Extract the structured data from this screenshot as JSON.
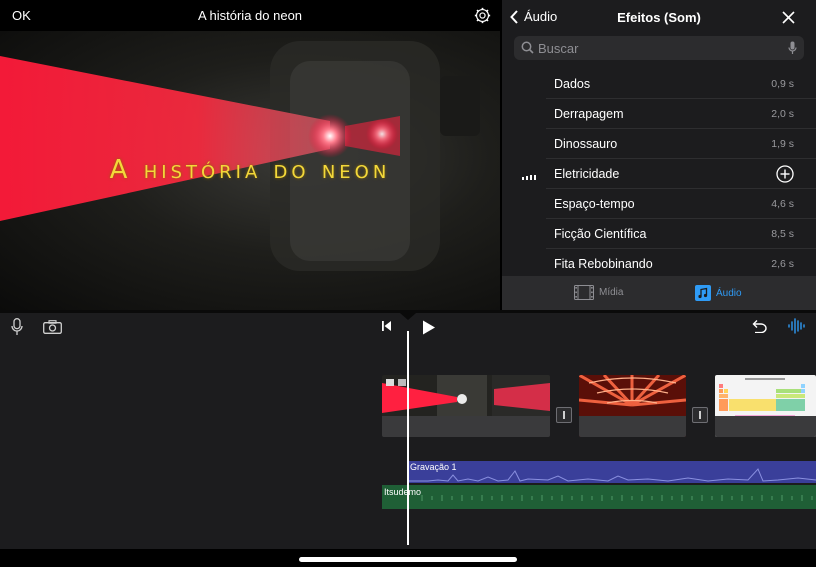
{
  "topbar": {
    "ok_label": "OK",
    "project_title": "A história do neon",
    "settings_icon": "gear-icon"
  },
  "viewer": {
    "overlay_title": "A história do neon"
  },
  "panel": {
    "back_label": "Áudio",
    "title": "Efeitos (Som)",
    "search_placeholder": "Buscar",
    "items": [
      {
        "label": "Dados",
        "duration": "0,9 s"
      },
      {
        "label": "Derrapagem",
        "duration": "2,0 s"
      },
      {
        "label": "Dinossauro",
        "duration": "1,9 s"
      },
      {
        "label": "Eletricidade",
        "duration": "",
        "selected": true
      },
      {
        "label": "Espaço-tempo",
        "duration": "4,6 s"
      },
      {
        "label": "Ficção Científica",
        "duration": "8,5 s"
      },
      {
        "label": "Fita Rebobinando",
        "duration": "2,6 s"
      }
    ],
    "tabs": [
      {
        "label": "Mídia",
        "icon": "film-icon",
        "active": false
      },
      {
        "label": "Áudio",
        "icon": "music-note-icon",
        "active": true
      }
    ],
    "accent_color": "#2f9bf5"
  },
  "timeline": {
    "audio_tracks": [
      {
        "label": "Gravação 1",
        "color": "#3a3f9a"
      },
      {
        "label": "Itsudemo",
        "color": "#1f5f36"
      }
    ]
  }
}
